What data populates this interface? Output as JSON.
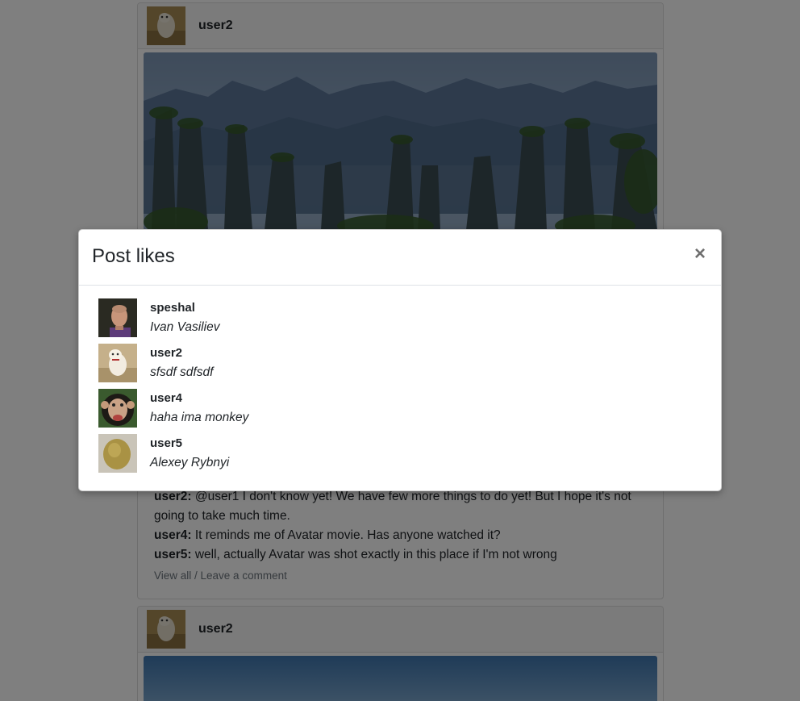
{
  "feed": {
    "posts": [
      {
        "username": "user2",
        "comments": [
          {
            "author": "user2:",
            "text": " @user1 I don't know yet! We have few more things to do yet! But I hope it's not going to take much time."
          },
          {
            "author": "user4:",
            "text": " It reminds me of Avatar movie. Has anyone watched it?"
          },
          {
            "author": "user5:",
            "text": " well, actually Avatar was shot exactly in this place if I'm not wrong"
          }
        ],
        "view_all_label": "View all / Leave a comment"
      },
      {
        "username": "user2"
      }
    ]
  },
  "modal": {
    "title": "Post likes",
    "close_label": "×",
    "likes": [
      {
        "username": "speshal",
        "full_name": "Ivan Vasiliev"
      },
      {
        "username": "user2",
        "full_name": "sfsdf sdfsdf"
      },
      {
        "username": "user4",
        "full_name": "haha ima monkey"
      },
      {
        "username": "user5",
        "full_name": "Alexey Rybnyi"
      }
    ]
  }
}
